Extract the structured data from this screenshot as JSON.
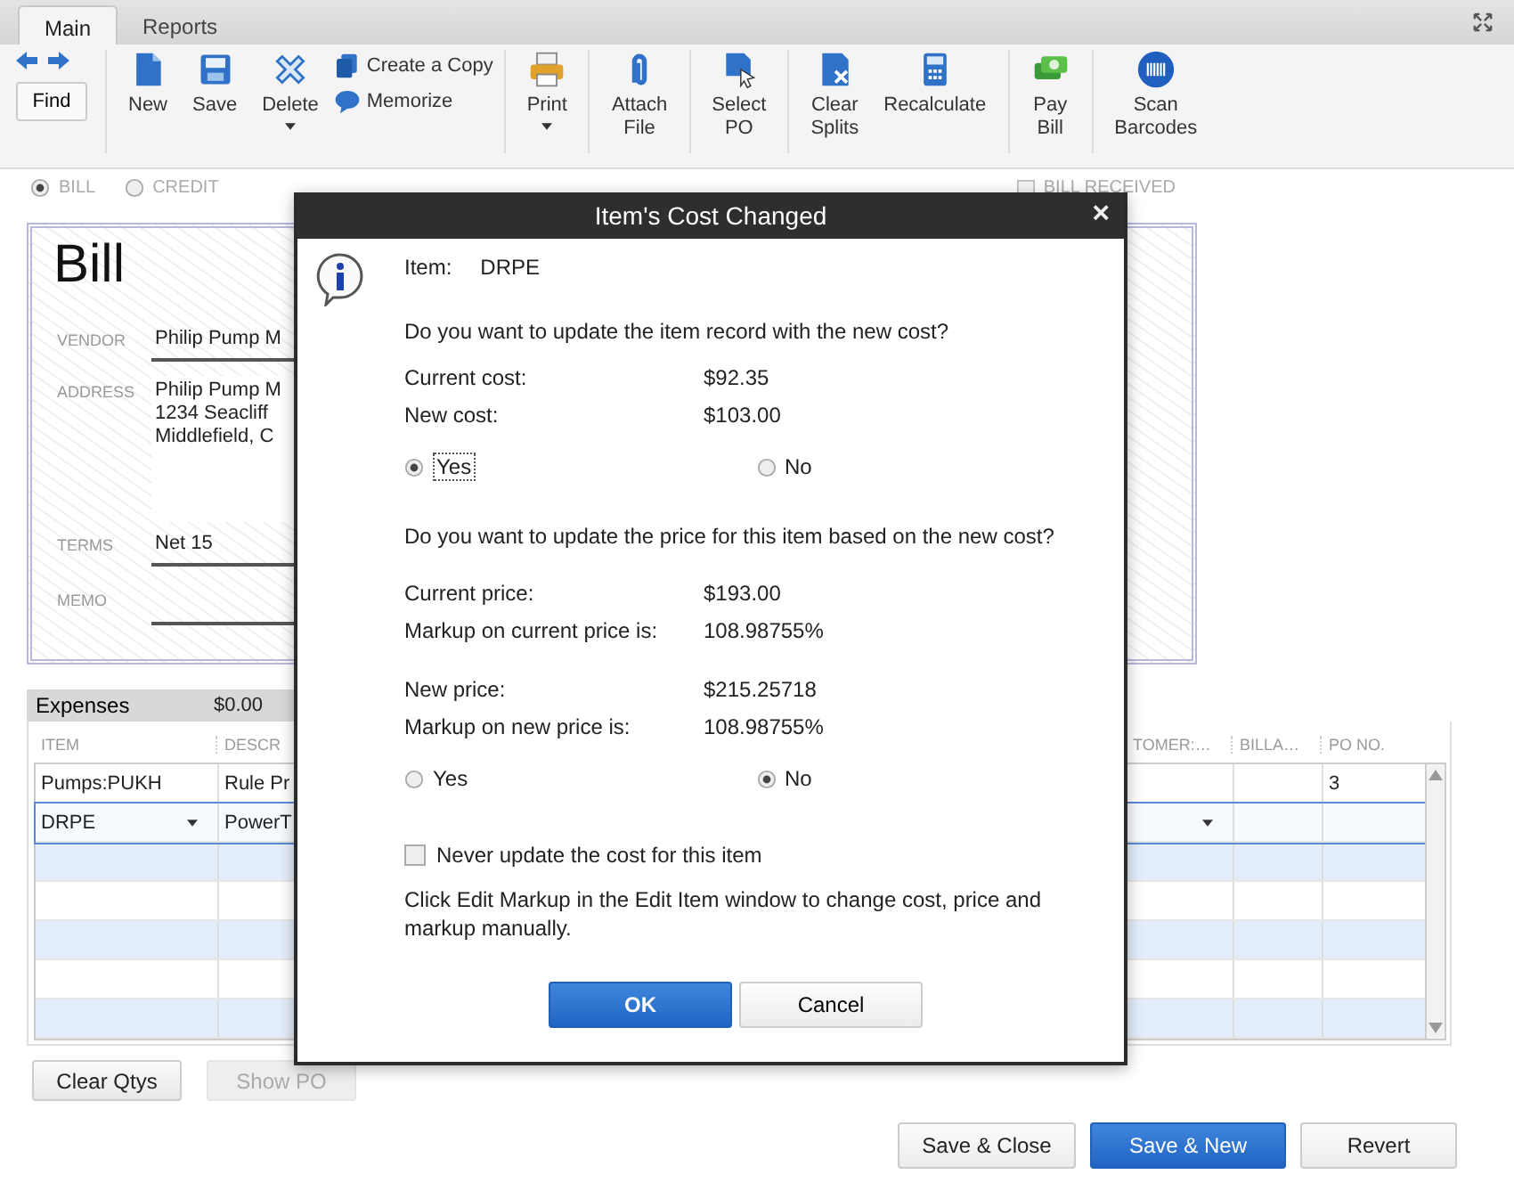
{
  "tabs": [
    {
      "label": "Main",
      "selected": true
    },
    {
      "label": "Reports",
      "selected": false
    }
  ],
  "toolbar": {
    "find": "Find",
    "groups": [
      {
        "items": [
          {
            "kind": "new",
            "label": "New"
          },
          {
            "kind": "save",
            "label": "Save"
          },
          {
            "kind": "delete",
            "label": "Delete",
            "dropdown": true
          },
          {
            "kind": "stack",
            "items": [
              {
                "kind": "copy",
                "label": "Create a Copy"
              },
              {
                "kind": "memorize",
                "label": "Memorize"
              }
            ]
          }
        ]
      },
      {
        "items": [
          {
            "kind": "print",
            "label": "Print",
            "dropdown": true
          }
        ]
      },
      {
        "items": [
          {
            "kind": "attach",
            "label": "Attach\nFile"
          }
        ]
      },
      {
        "items": [
          {
            "kind": "select",
            "label": "Select\nPO"
          }
        ]
      },
      {
        "items": [
          {
            "kind": "clear",
            "label": "Clear\nSplits"
          },
          {
            "kind": "calc",
            "label": "Recalculate"
          }
        ]
      },
      {
        "items": [
          {
            "kind": "pay",
            "label": "Pay\nBill"
          }
        ]
      },
      {
        "items": [
          {
            "kind": "scan",
            "label": "Scan\nBarcodes"
          }
        ]
      }
    ]
  },
  "bill_type": [
    {
      "label": "BILL",
      "selected": true
    },
    {
      "label": "CREDIT",
      "selected": false
    }
  ],
  "bill_received": {
    "label": "BILL RECEIVED",
    "checked": false
  },
  "bill": {
    "title": "Bill",
    "vendor_label": "VENDOR",
    "vendor": "Philip Pump M",
    "address_label": "ADDRESS",
    "address": [
      "Philip Pump M",
      "1234 Seacliff",
      "Middlefield, C"
    ],
    "terms_label": "TERMS",
    "terms": "Net 15",
    "memo_label": "MEMO"
  },
  "expenses_tab": {
    "label": "Expenses",
    "amount": "$0.00"
  },
  "table": {
    "columns": [
      "ITEM",
      "DESCR",
      "TOMER:…",
      "BILLA…",
      "PO NO."
    ],
    "rows": [
      {
        "item": "Pumps:PUKH",
        "description": "Rule Pr",
        "po_no": "3",
        "selected": false
      },
      {
        "item": "DRPE",
        "description": "PowerT",
        "selected": true
      }
    ]
  },
  "table_buttons": [
    {
      "label": "Clear Qtys",
      "disabled": false
    },
    {
      "label": "Show PO",
      "disabled": true
    }
  ],
  "footer_buttons": [
    {
      "label": "Save & Close",
      "kind": "default"
    },
    {
      "label": "Save & New",
      "kind": "primary"
    },
    {
      "label": "Revert",
      "kind": "default"
    }
  ],
  "dialog": {
    "title": "Item's Cost Changed",
    "close": "×",
    "item_label": "Item:",
    "item": "DRPE",
    "question_cost": "Do you want to update the item record with the new cost?",
    "cost_rows": [
      {
        "label": "Current cost:",
        "value": "$92.35"
      },
      {
        "label": "New cost:",
        "value": "$103.00"
      }
    ],
    "cost_choice": [
      {
        "label": "Yes",
        "selected": true
      },
      {
        "label": "No",
        "selected": false
      }
    ],
    "question_price": "Do you want to update the price for this item based on the new cost?",
    "current_price_rows": [
      {
        "label": "Current price:",
        "value": "$193.00"
      },
      {
        "label": "Markup on current price is:",
        "value": "108.98755%"
      }
    ],
    "new_price_rows": [
      {
        "label": "New price:",
        "value": "$215.25718"
      },
      {
        "label": "Markup on new price is:",
        "value": "108.98755%"
      }
    ],
    "price_choice": [
      {
        "label": "Yes",
        "selected": false
      },
      {
        "label": "No",
        "selected": true
      }
    ],
    "never_update": {
      "label": "Never update the cost for this item",
      "checked": false
    },
    "note": "Click Edit Markup in the Edit Item window to change cost, price and markup manually.",
    "buttons": [
      {
        "label": "OK",
        "kind": "primary"
      },
      {
        "label": "Cancel",
        "kind": "default"
      }
    ]
  }
}
